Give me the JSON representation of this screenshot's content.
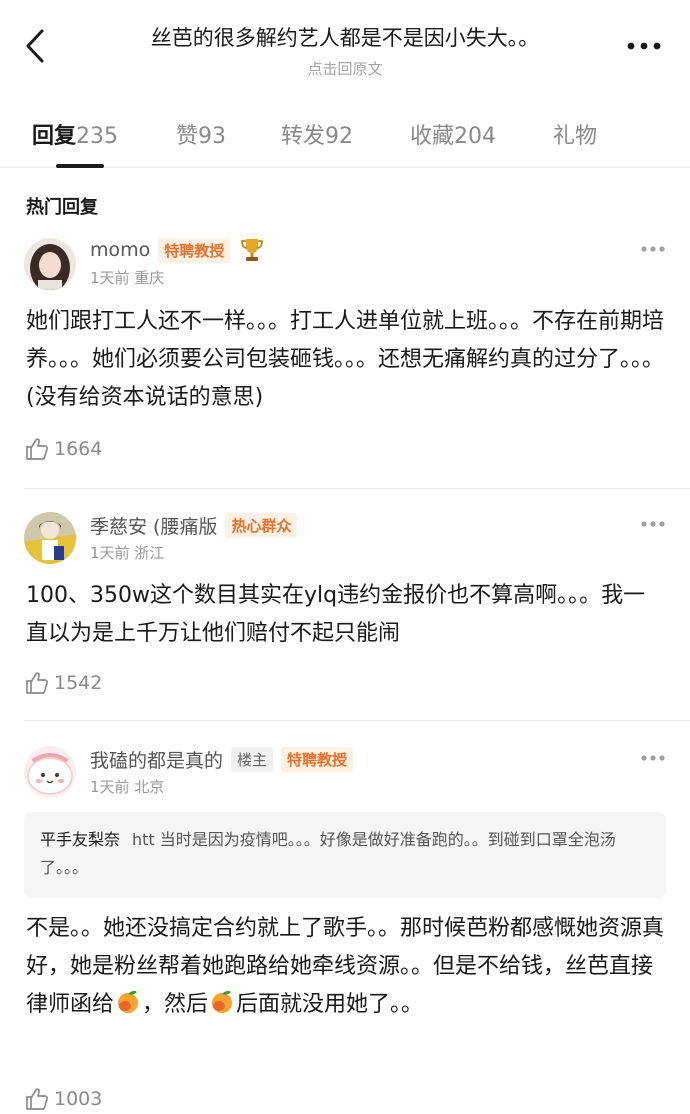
{
  "header": {
    "title": "丝芭的很多解约艺人都是不是因小失大。。",
    "subtitle": "点击回原文",
    "back_icon": "chevron-left-icon",
    "more_icon": "more-dots-icon"
  },
  "tabs": [
    {
      "label": "回复",
      "count": "235"
    },
    {
      "label": "赞",
      "count": "93"
    },
    {
      "label": "转发",
      "count": "92"
    },
    {
      "label": "收藏",
      "count": "204"
    },
    {
      "label": "礼物",
      "count": ""
    }
  ],
  "section_title": "热门回复",
  "comments": [
    {
      "username": "momo",
      "badges": [
        "特聘教授"
      ],
      "trophy_icon": "trophy-icon",
      "meta": "1天前 重庆",
      "text": "她们跟打工人还不一样。。。打工人进单位就上班。。。不存在前期培养。。。她们必须要公司包装砸钱。。。还想无痛解约真的过分了。。。(没有给资本说话的意思)",
      "likes": "1664"
    },
    {
      "username": "季慈安 (腰痛版",
      "badges": [
        "热心群众"
      ],
      "meta": "1天前 浙江",
      "text": "100、350w这个数目其实在ylq违约金报价也不算高啊。。。我一直以为是上千万让他们赔付不起只能闹",
      "likes": "1542"
    },
    {
      "username": "我磕的都是真的",
      "badges": [
        "楼主",
        "特聘教授"
      ],
      "meta": "1天前 北京",
      "quote": {
        "name": "平手友梨奈",
        "text": "htt 当时是因为疫情吧。。。好像是做好准备跑的。。到碰到口罩全泡汤了。。。"
      },
      "text_parts": [
        "不是。。她还没搞定合约就上了歌手。。那时候芭粉都感慨她资源真好，她是粉丝帮着她跑路给她牵线资源。。但是不给钱，丝芭直接律师函给",
        "，然后",
        "后面就没用她了。。"
      ],
      "emoji": "mango-emoji",
      "likes": "1003"
    }
  ],
  "colors": {
    "badge_orange": "#e8722c",
    "text_primary": "#1a1a1a",
    "text_secondary": "#9a9a9a"
  }
}
